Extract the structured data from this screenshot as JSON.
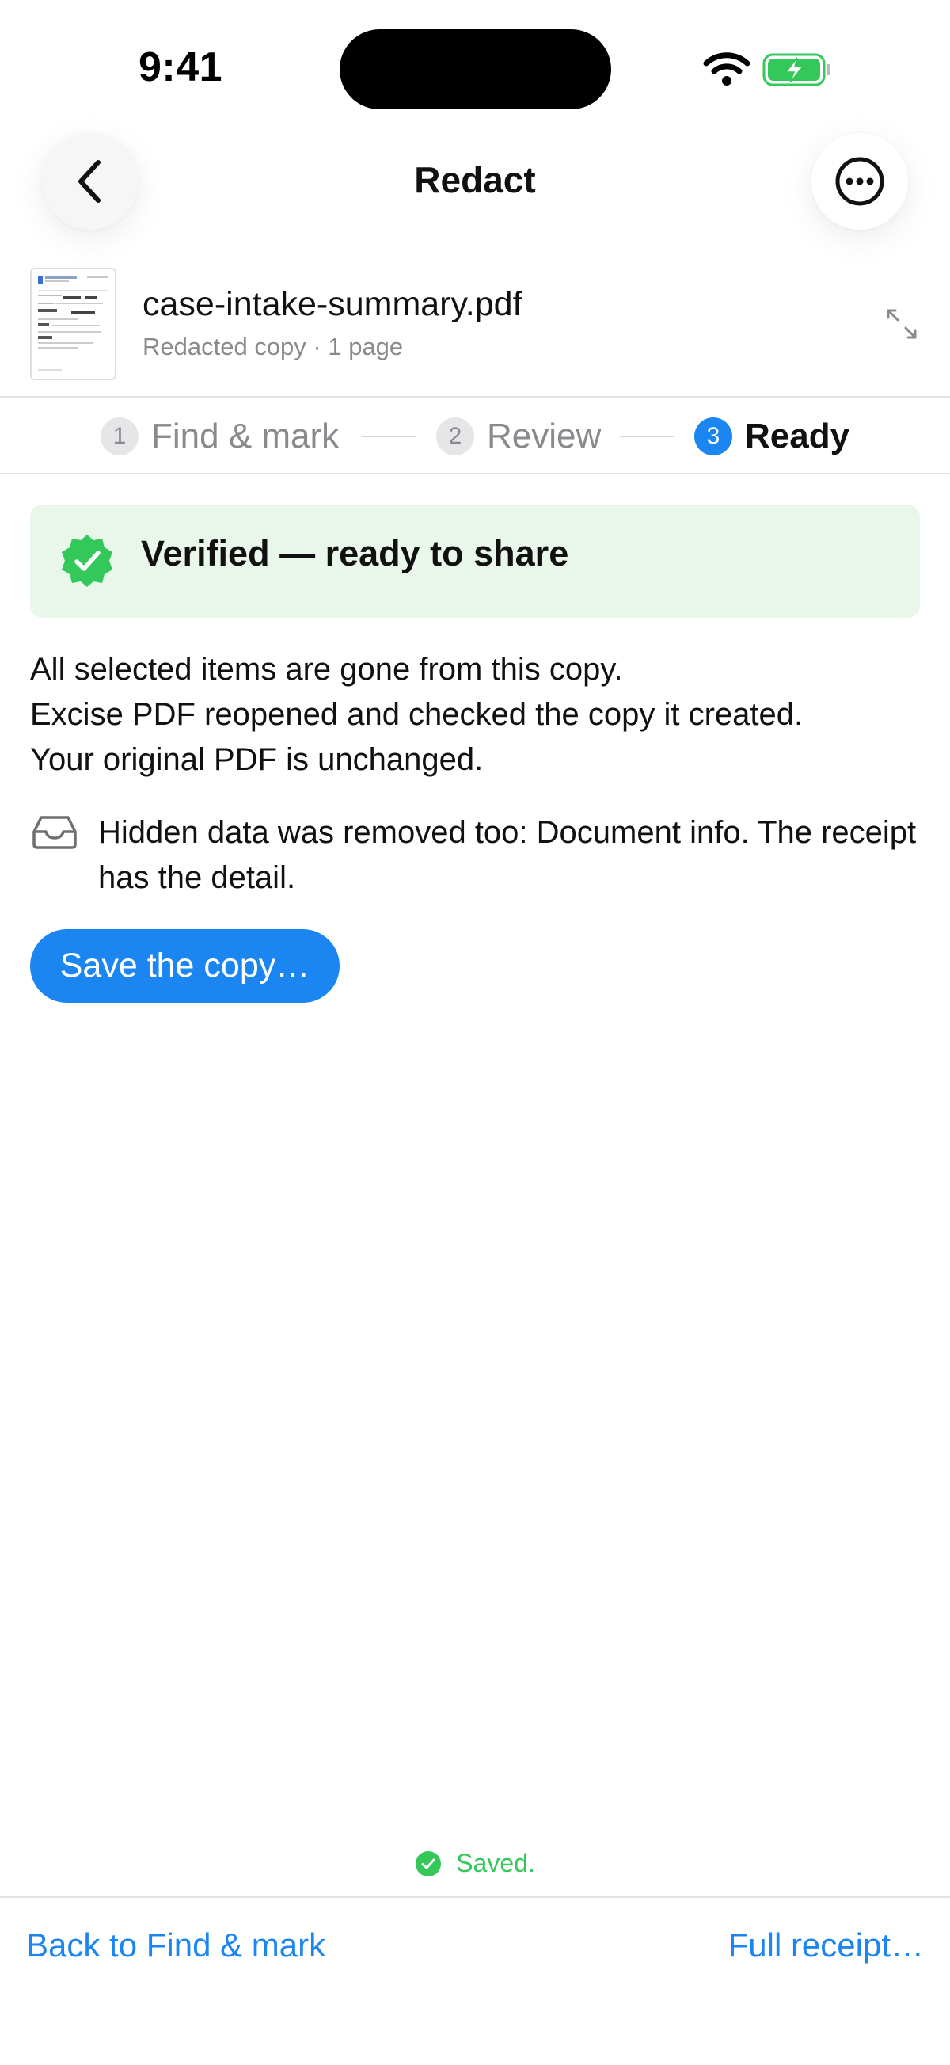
{
  "status_bar": {
    "time": "9:41"
  },
  "nav": {
    "title": "Redact",
    "back_icon": "chevron-left-icon",
    "more_icon": "ellipsis-circle-icon"
  },
  "file": {
    "name": "case-intake-summary.pdf",
    "subtitle": "Redacted copy · 1 page"
  },
  "steps": [
    {
      "number": "1",
      "label": "Find & mark",
      "state": "done"
    },
    {
      "number": "2",
      "label": "Review",
      "state": "done"
    },
    {
      "number": "3",
      "label": "Ready",
      "state": "active"
    }
  ],
  "banner": {
    "text": "Verified — ready to share",
    "color": "#34c759"
  },
  "body": {
    "lines": [
      "All selected items are gone from this copy.",
      "Excise PDF reopened and checked the copy it created.",
      "Your original PDF is unchanged."
    ],
    "hidden_note": "Hidden data was removed too: Document info. The receipt has the detail."
  },
  "actions": {
    "save_label": "Save the copy…"
  },
  "footer": {
    "saved_text": "Saved.",
    "back_link": "Back to Find & mark",
    "receipt_link": "Full receipt…"
  },
  "colors": {
    "accent": "#1b86f1",
    "success": "#34c759",
    "banner_bg": "#e9f6ea"
  }
}
